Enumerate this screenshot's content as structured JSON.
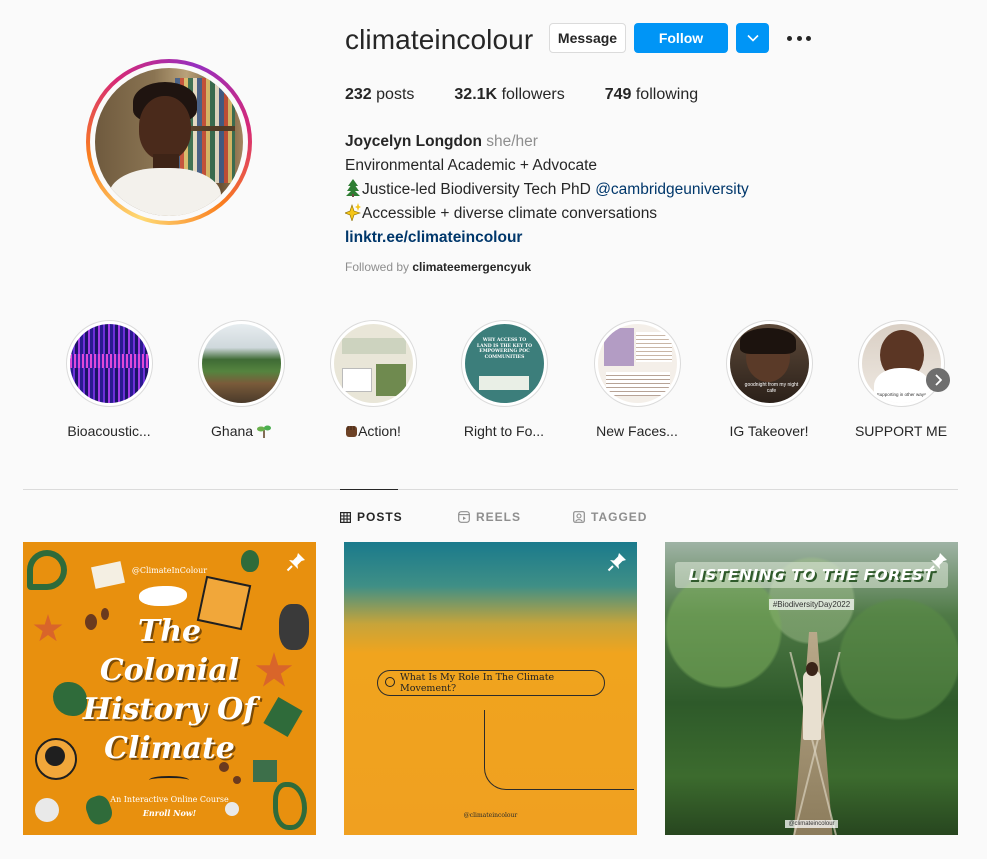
{
  "profile": {
    "username": "climateincolour",
    "message_label": "Message",
    "follow_label": "Follow",
    "stats": {
      "posts_count": "232",
      "posts_label": "posts",
      "followers_count": "32.1K",
      "followers_label": "followers",
      "following_count": "749",
      "following_label": "following"
    },
    "bio": {
      "name": "Joycelyn Longdon",
      "pronouns": "she/her",
      "line1": "Environmental Academic + Advocate",
      "line2_text": "Justice-led Biodiversity Tech PhD ",
      "line2_mention": "@cambridgeuniversity",
      "line3_text": "Accessible + diverse climate conversations",
      "link": "linktr.ee/climateincolour"
    },
    "followed_by_prefix": "Followed by ",
    "followed_by_user": "climateemergencyuk"
  },
  "highlights": [
    {
      "label": "Bioacoustic..."
    },
    {
      "label": "Ghana"
    },
    {
      "label": "Action!"
    },
    {
      "label": "Right to Fo..."
    },
    {
      "label": "New Faces..."
    },
    {
      "label": "IG Takeover!"
    },
    {
      "label": "SUPPORT ME"
    }
  ],
  "highlight_text": {
    "right_to_food": "WHY ACCESS TO LAND IS THE KEY TO EMPOWERING POC COMMUNITIES",
    "ig_takeover": "goodnight from my night cafe",
    "support_me": "Supporting in other ways"
  },
  "tabs": [
    {
      "label": "POSTS"
    },
    {
      "label": "REELS"
    },
    {
      "label": "TAGGED"
    }
  ],
  "posts": {
    "p1": {
      "handle": "@ClimateInColour",
      "title_lines": [
        "The",
        "Colonial",
        "History Of",
        "Climate"
      ],
      "subtitle": "An Interactive Online Course",
      "cta": "Enroll Now!"
    },
    "p2": {
      "search_text": "What Is My Role In The Climate Movement?",
      "handle": "@climateincolour"
    },
    "p3": {
      "title": "LISTENING TO THE FOREST",
      "tag": "#BiodiversityDay2022",
      "handle": "@climateincolour"
    }
  },
  "colors": {
    "follow_blue": "#0095f6",
    "text": "#262626",
    "muted": "#8e8e8e",
    "link": "#00376b"
  }
}
